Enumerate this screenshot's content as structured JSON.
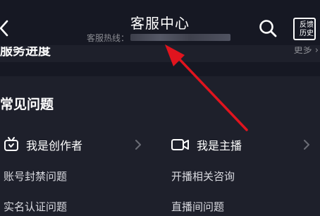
{
  "header": {
    "title": "客服中心",
    "hotline_label": "客服热线：",
    "feedback_history_line1": "反馈",
    "feedback_history_line2": "历史"
  },
  "progress_section": {
    "title": "服务进度",
    "more_label": "更多"
  },
  "faq": {
    "title": "常见问题",
    "categories": [
      {
        "label": "我是创作者",
        "icon": "tv-icon"
      },
      {
        "label": "我是主播",
        "icon": "video-camera-icon"
      }
    ],
    "questions": [
      "账号封禁问题",
      "开播相关咨询",
      "实名认证问题",
      "直播间问题"
    ]
  },
  "colors": {
    "background": "#161823",
    "panel": "#1e202b",
    "annotation_arrow": "#e0141e"
  }
}
